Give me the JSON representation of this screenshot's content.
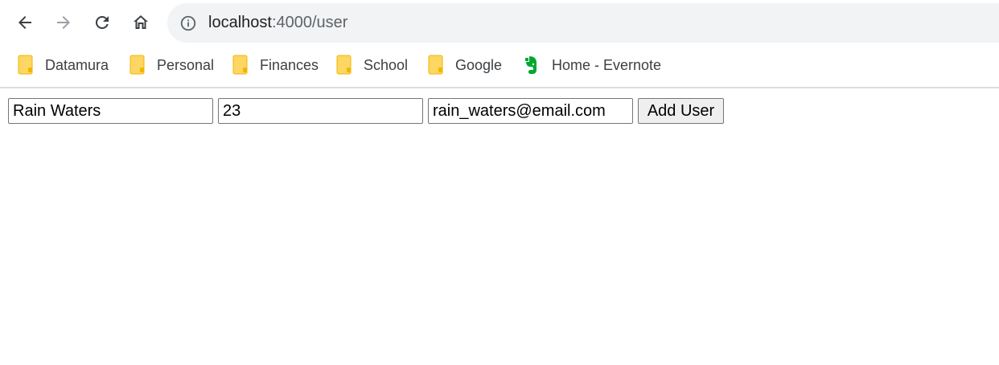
{
  "browser": {
    "url_host": "localhost",
    "url_path": ":4000/user",
    "colors": {
      "omnibox_bg": "#f1f3f4",
      "folder_yellow": "#fdd663",
      "evernote_green": "#00a82d"
    }
  },
  "bookmarks": [
    {
      "label": "Datamura",
      "icon": "folder-icon"
    },
    {
      "label": "Personal",
      "icon": "folder-icon"
    },
    {
      "label": "Finances",
      "icon": "folder-icon"
    },
    {
      "label": "School",
      "icon": "folder-icon"
    },
    {
      "label": "Google",
      "icon": "folder-icon"
    },
    {
      "label": "Home - Evernote",
      "icon": "evernote-icon"
    }
  ],
  "form": {
    "name_value": "Rain Waters",
    "age_value": "23",
    "email_value": "rain_waters@email.com",
    "add_button_label": "Add User"
  }
}
